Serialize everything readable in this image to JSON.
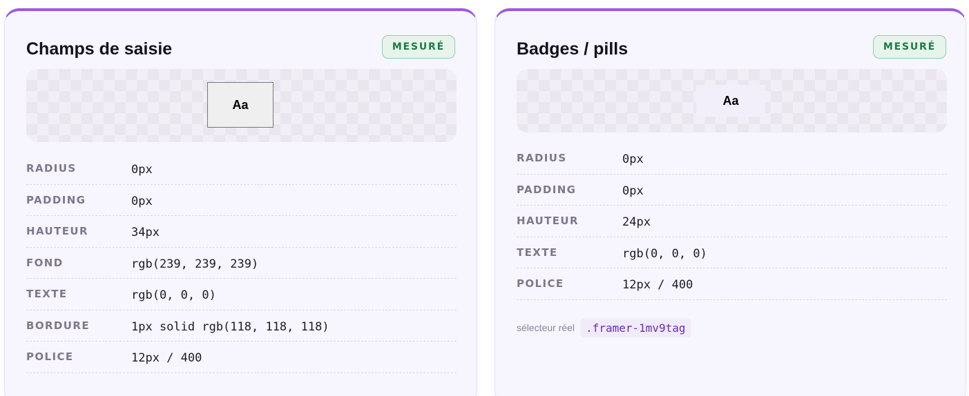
{
  "cards": [
    {
      "title": "Champs de saisie",
      "badge": "MESURÉ",
      "sample_text": "Aa",
      "properties": [
        {
          "key": "RADIUS",
          "value": "0px"
        },
        {
          "key": "PADDING",
          "value": "0px"
        },
        {
          "key": "HAUTEUR",
          "value": "34px"
        },
        {
          "key": "FOND",
          "value": "rgb(239, 239, 239)"
        },
        {
          "key": "TEXTE",
          "value": "rgb(0, 0, 0)"
        },
        {
          "key": "BORDURE",
          "value": "1px solid rgb(118, 118, 118)"
        },
        {
          "key": "POLICE",
          "value": "12px / 400"
        }
      ]
    },
    {
      "title": "Badges / pills",
      "badge": "MESURÉ",
      "sample_text": "Aa",
      "properties": [
        {
          "key": "RADIUS",
          "value": "0px"
        },
        {
          "key": "PADDING",
          "value": "0px"
        },
        {
          "key": "HAUTEUR",
          "value": "24px"
        },
        {
          "key": "TEXTE",
          "value": "rgb(0, 0, 0)"
        },
        {
          "key": "POLICE",
          "value": "12px / 400"
        }
      ],
      "selector_label": "sélecteur réel",
      "selector_code": ".framer-1mv9tag"
    }
  ],
  "colors": {
    "card_top_border": "#9b59e0",
    "badge_text": "#1f7a45",
    "badge_bg": "#e6f4ec",
    "selector_code": "#6b2bb3"
  }
}
